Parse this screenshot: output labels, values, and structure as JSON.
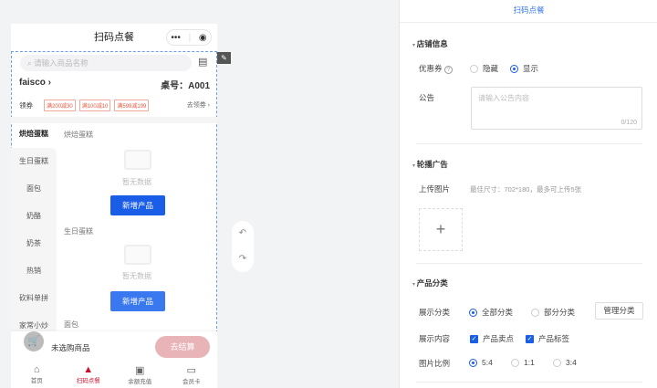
{
  "phone": {
    "title": "扫码点餐",
    "capsule_more": "•••",
    "capsule_close": "◉",
    "search_placeholder": "请输入商品名称",
    "store_name": "faisco",
    "table_no": "桌号：A001",
    "coupon_label": "领券",
    "coupons": [
      "满200减30",
      "满100减10",
      "满599减199"
    ],
    "get_coupon": "去领券 ›",
    "categories": [
      "烘焙蛋糕",
      "生日蛋糕",
      "面包",
      "奶酪",
      "奶茶",
      "热销",
      "砍料单拼",
      "家常小炒"
    ],
    "sections": [
      {
        "title": "烘焙蛋糕",
        "empty": "暂无数据",
        "button": "新增产品"
      },
      {
        "title": "生日蛋糕",
        "empty": "暂无数据",
        "button": "新增产品"
      },
      {
        "title": "面包"
      }
    ],
    "cart_text": "未选购商品",
    "checkout": "去结算",
    "tabs": [
      {
        "label": "首页"
      },
      {
        "label": "扫码点餐"
      },
      {
        "label": "余额充值"
      },
      {
        "label": "会员卡"
      }
    ]
  },
  "panel": {
    "title": "扫码点餐",
    "store_info": {
      "title": "店铺信息",
      "coupon_label": "优惠券",
      "opt_hide": "隐藏",
      "opt_show": "显示",
      "selected": "显示",
      "notice_label": "公告",
      "notice_placeholder": "请输入公告内容",
      "notice_count": "0/120"
    },
    "banner": {
      "title": "轮播广告",
      "upload_label": "上传图片",
      "upload_hint": "最佳尺寸：702*180，最多可上传5张"
    },
    "category": {
      "title": "产品分类",
      "display_label": "展示分类",
      "opt_all": "全部分类",
      "opt_part": "部分分类",
      "manage": "管理分类",
      "content_label": "展示内容",
      "chk_selling": "产品卖点",
      "chk_tag": "产品标签",
      "ratio_label": "图片比例",
      "ratios": [
        "5:4",
        "1:1",
        "3:4"
      ],
      "ratio_selected": "5:4"
    }
  },
  "colors": {
    "accent": "#1a5ee8",
    "tab_active": "#c8102e",
    "checkout": "#e8b4b8"
  }
}
